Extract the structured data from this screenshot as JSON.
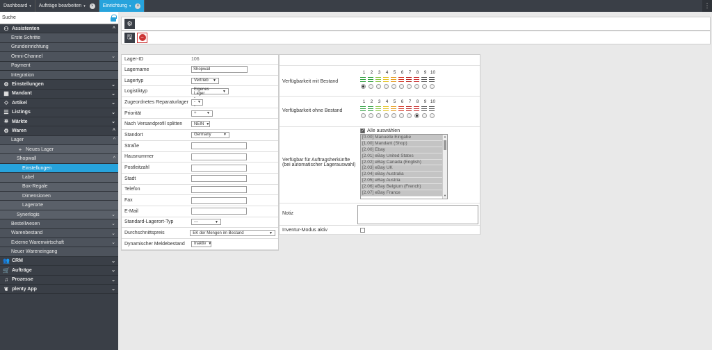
{
  "tabs": [
    {
      "label": "Dashboard",
      "caret": "▾",
      "close": ""
    },
    {
      "label": "Aufträge bearbeiten",
      "caret": "▾",
      "close": "×"
    },
    {
      "label": "Einrichtung",
      "caret": "▾",
      "close": "×"
    }
  ],
  "sidebar": {
    "search_label": "Suche",
    "items": [
      {
        "label": "Assistenten",
        "level": 0,
        "icon": "⚇",
        "chevron": "^"
      },
      {
        "label": "Erste Schritte",
        "level": 1
      },
      {
        "label": "Grundeinrichtung",
        "level": 1
      },
      {
        "label": "Omni-Channel",
        "level": 1,
        "chevron": "⌄"
      },
      {
        "label": "Payment",
        "level": 1
      },
      {
        "label": "Integration",
        "level": 1
      },
      {
        "label": "Einstellungen",
        "level": 0,
        "icon": "⚙",
        "chevron": "⌄"
      },
      {
        "label": "Mandant",
        "level": 0,
        "icon": "▦",
        "chevron": "⌄"
      },
      {
        "label": "Artikel",
        "level": 0,
        "icon": "⬦",
        "chevron": "⌄"
      },
      {
        "label": "Listings",
        "level": 0,
        "icon": "☰",
        "chevron": "⌄"
      },
      {
        "label": "Märkte",
        "level": 0,
        "icon": "⛯",
        "chevron": "⌄"
      },
      {
        "label": "Waren",
        "level": 0,
        "icon": "⚙",
        "chevron": "^"
      },
      {
        "label": "Lager",
        "level": 1,
        "chevron": "^"
      },
      {
        "label": "Neues Lager",
        "level": 2,
        "icon": "+"
      },
      {
        "label": "Shopwall",
        "level": 2,
        "chevron": "^"
      },
      {
        "label": "Einstellungen",
        "level": 3,
        "active": true
      },
      {
        "label": "Label",
        "level": 3
      },
      {
        "label": "Box-Regale",
        "level": 3
      },
      {
        "label": "Dimensionen",
        "level": 3
      },
      {
        "label": "Lagerorte",
        "level": 3
      },
      {
        "label": "Synerlogis",
        "level": 2,
        "chevron": "⌄"
      },
      {
        "label": "Bestellwesen",
        "level": 1,
        "chevron": "⌄"
      },
      {
        "label": "Warenbestand",
        "level": 1,
        "chevron": "⌄"
      },
      {
        "label": "Externe Warenwirtschaft",
        "level": 1,
        "chevron": "⌄"
      },
      {
        "label": "Neuer Wareneingang",
        "level": 1
      },
      {
        "label": "CRM",
        "level": 0,
        "icon": "👥",
        "chevron": "⌄"
      },
      {
        "label": "Aufträge",
        "level": 0,
        "icon": "🛒",
        "chevron": "⌄"
      },
      {
        "label": "Prozesse",
        "level": 0,
        "icon": "♫",
        "chevron": "⌄"
      },
      {
        "label": "plenty App",
        "level": 0,
        "icon": "❦",
        "chevron": "⌄"
      }
    ]
  },
  "toolbar": {
    "settings_icon": "⚙",
    "save_icon": "🖫",
    "delete_icon": "−"
  },
  "form_left": {
    "rows": [
      {
        "label": "Lager-ID",
        "type": "text",
        "value": "106"
      },
      {
        "label": "Lagername",
        "type": "input",
        "value": "Shopwall"
      },
      {
        "label": "Lagertyp",
        "type": "select",
        "value": "Vertrieb"
      },
      {
        "label": "Logistiktyp",
        "type": "select",
        "value": "Eigenes Lager"
      },
      {
        "label": "Zugeordnetes Reparaturlager",
        "type": "select",
        "value": "---"
      },
      {
        "label": "Priorität",
        "type": "select",
        "value": "+"
      },
      {
        "label": "Nach Versandprofil splitten",
        "type": "select",
        "value": "NEIN"
      },
      {
        "label": "Standort",
        "type": "select",
        "value": "Germany"
      },
      {
        "label": "Straße",
        "type": "input",
        "value": ""
      },
      {
        "label": "Hausnummer",
        "type": "input",
        "value": ""
      },
      {
        "label": "Postleitzahl",
        "type": "input",
        "value": ""
      },
      {
        "label": "Stadt",
        "type": "input",
        "value": ""
      },
      {
        "label": "Telefon",
        "type": "input",
        "value": ""
      },
      {
        "label": "Fax",
        "type": "input",
        "value": ""
      },
      {
        "label": "E-Mail",
        "type": "input",
        "value": ""
      },
      {
        "label": "Standard-Lagerort-Typ",
        "type": "select",
        "value": "---"
      },
      {
        "label": "Durchschnittspreis",
        "type": "select",
        "value": "EK der Mengen im Bestand"
      },
      {
        "label": "Dynamischer Meldebestand",
        "type": "select",
        "value": "Inaktiv"
      }
    ]
  },
  "form_right": {
    "availability_with_stock_label": "Verfügbarkeit mit Bestand",
    "availability_without_stock_label": "Verfügbarkeit ohne Bestand",
    "levels": [
      "1",
      "2",
      "3",
      "4",
      "5",
      "6",
      "7",
      "8",
      "9",
      "10"
    ],
    "level_colors": [
      "#2e9e3e",
      "#2e9e3e",
      "#8ac43f",
      "#e5c21c",
      "#e59b1c",
      "#d3311f",
      "#b8221c",
      "#c82b2b",
      "#555555",
      "#555555"
    ],
    "selected_with_stock": "1",
    "selected_without_stock": "8",
    "origins_label_line1": "Verfügbar für Auftragsherkünfte",
    "origins_label_line2": "(bei automatischer Lagerauswahl)",
    "select_all_label": "Alle auswählen",
    "select_all_checked": true,
    "origins": [
      "[0.00] Manuelle Eingabe",
      "[1.00] Mandant (Shop)",
      "[2.00] Ebay",
      "[2.01] eBay United States",
      "[2.02] eBay Canada (English)",
      "[2.03] eBay UK",
      "[2.04] eBay Australia",
      "[2.05] eBay Austria",
      "[2.06] eBay Belgium (French)",
      "[2.07] eBay France"
    ],
    "notes_label": "Notiz",
    "notes_value": "",
    "inventory_mode_label": "Inventur-Modus aktiv",
    "inventory_mode_checked": false
  }
}
